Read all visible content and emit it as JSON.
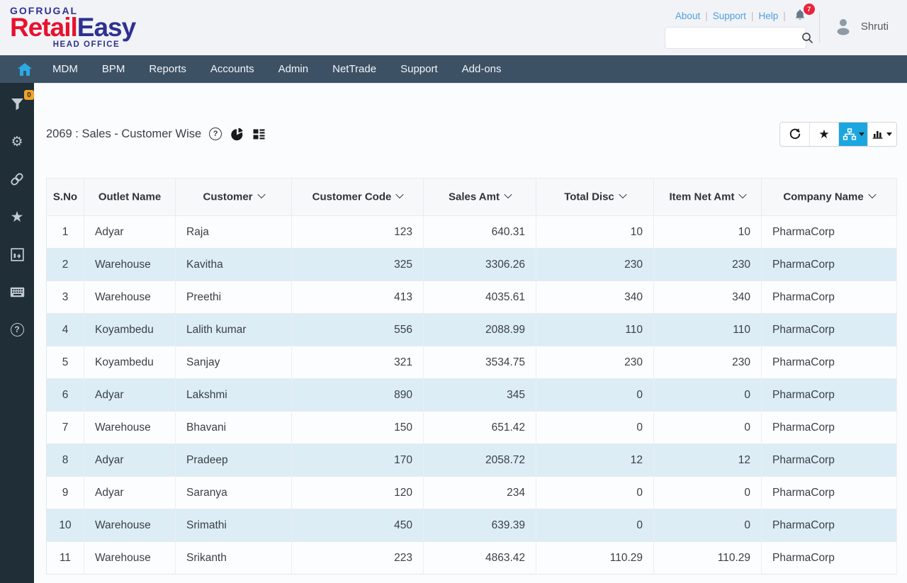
{
  "header": {
    "logo": {
      "top": "GOFRUGAL",
      "retail": "Retail",
      "easy": "Easy",
      "sub": "HEAD OFFICE"
    },
    "links": [
      "About",
      "Support",
      "Help"
    ],
    "notification_count": "7",
    "search": {
      "value": "",
      "placeholder": ""
    },
    "user": "Shruti"
  },
  "nav": {
    "items": [
      "MDM",
      "BPM",
      "Reports",
      "Accounts",
      "Admin",
      "NetTrade",
      "Support",
      "Add-ons"
    ]
  },
  "sidebar": {
    "filter_badge": "0",
    "icons": [
      "filter",
      "settings",
      "link",
      "favorites",
      "export",
      "keyboard",
      "help"
    ]
  },
  "report": {
    "title": "2069 : Sales - Customer Wise"
  },
  "toolbar": {
    "buttons": [
      "refresh",
      "favorite",
      "hierarchy-view",
      "chart-view"
    ],
    "active": "hierarchy-view"
  },
  "table": {
    "columns": [
      {
        "label": "S.No",
        "sortable": false
      },
      {
        "label": "Outlet Name",
        "sortable": false
      },
      {
        "label": "Customer",
        "sortable": true
      },
      {
        "label": "Customer Code",
        "sortable": true
      },
      {
        "label": "Sales Amt",
        "sortable": true
      },
      {
        "label": "Total Disc",
        "sortable": true
      },
      {
        "label": "Item Net Amt",
        "sortable": true
      },
      {
        "label": "Company Name",
        "sortable": true
      }
    ],
    "rows": [
      [
        "1",
        "Adyar",
        "Raja",
        "123",
        "640.31",
        "10",
        "10",
        "PharmaCorp"
      ],
      [
        "2",
        "Warehouse",
        "Kavitha",
        "325",
        "3306.26",
        "230",
        "230",
        "PharmaCorp"
      ],
      [
        "3",
        "Warehouse",
        "Preethi",
        "413",
        "4035.61",
        "340",
        "340",
        "PharmaCorp"
      ],
      [
        "4",
        "Koyambedu",
        "Lalith kumar",
        "556",
        "2088.99",
        "110",
        "110",
        "PharmaCorp"
      ],
      [
        "5",
        "Koyambedu",
        "Sanjay",
        "321",
        "3534.75",
        "230",
        "230",
        "PharmaCorp"
      ],
      [
        "6",
        "Adyar",
        "Lakshmi",
        "890",
        "345",
        "0",
        "0",
        "PharmaCorp"
      ],
      [
        "7",
        "Warehouse",
        "Bhavani",
        "150",
        "651.42",
        "0",
        "0",
        "PharmaCorp"
      ],
      [
        "8",
        "Adyar",
        "Pradeep",
        "170",
        "2058.72",
        "12",
        "12",
        "PharmaCorp"
      ],
      [
        "9",
        "Adyar",
        "Saranya",
        "120",
        "234",
        "0",
        "0",
        "PharmaCorp"
      ],
      [
        "10",
        "Warehouse",
        "Srimathi",
        "450",
        "639.39",
        "0",
        "0",
        "PharmaCorp"
      ],
      [
        "11",
        "Warehouse",
        "Srikanth",
        "223",
        "4863.42",
        "110.29",
        "110.29",
        "PharmaCorp"
      ]
    ]
  },
  "colors": {
    "accent_blue": "#1ca6e0",
    "nav_bg": "#3d5165",
    "sidebar_bg": "#1f2e37",
    "logo_red": "#e8112d",
    "logo_navy": "#2e3192",
    "link_blue": "#4d9fdc",
    "stripe_blue": "#dcedf6",
    "badge_red": "#e8253a",
    "badge_orange": "#f0a32e"
  }
}
